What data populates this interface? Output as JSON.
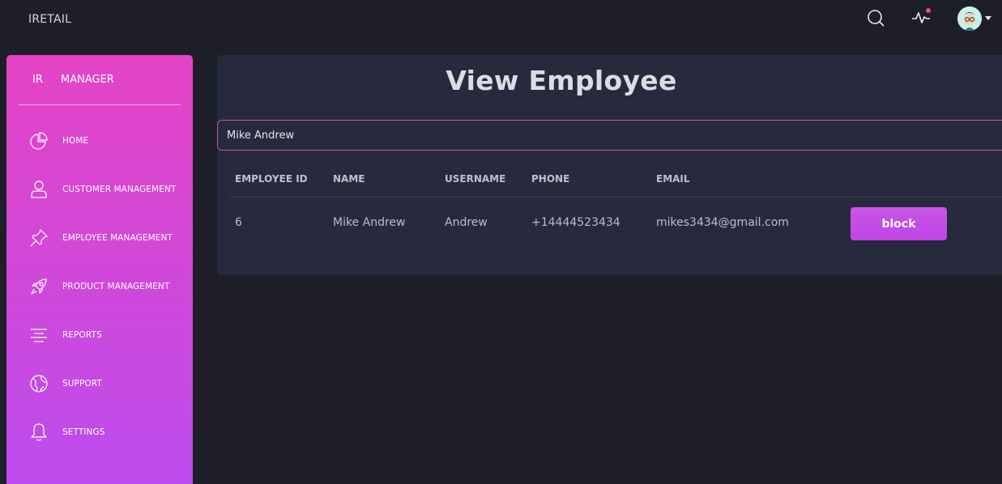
{
  "app": {
    "brand": "IRETAIL"
  },
  "topbar": {
    "icons": [
      "search-icon",
      "pulse-icon",
      "avatar",
      "caret-down-icon"
    ],
    "notification_color": "#ec4c8a"
  },
  "sidebar": {
    "logo_mini": "IR",
    "logo_full": "MANAGER",
    "items": [
      {
        "label": "HOME",
        "icon": "pie-chart-icon"
      },
      {
        "label": "CUSTOMER MANAGEMENT",
        "icon": "user-icon"
      },
      {
        "label": "EMPLOYEE MANAGEMENT",
        "icon": "pin-icon"
      },
      {
        "label": "PRODUCT MANAGEMENT",
        "icon": "rocket-icon"
      },
      {
        "label": "REPORTS",
        "icon": "align-center-icon"
      },
      {
        "label": "SUPPORT",
        "icon": "globe-icon"
      },
      {
        "label": "SETTINGS",
        "icon": "bell-icon"
      }
    ],
    "gradient": [
      "#e444c5",
      "#bc4cef"
    ]
  },
  "main": {
    "title": "View Employee",
    "search": {
      "value": "Mike Andrew",
      "placeholder": ""
    },
    "table": {
      "headers": [
        "EMPLOYEE ID",
        "NAME",
        "USERNAME",
        "PHONE",
        "EMAIL"
      ],
      "rows": [
        {
          "id": "6",
          "name": "Mike Andrew",
          "username": "Andrew",
          "phone": "+14444523434",
          "email": "mikes3434@gmail.com",
          "action": "block"
        }
      ]
    },
    "accent": "#c94ae0"
  }
}
